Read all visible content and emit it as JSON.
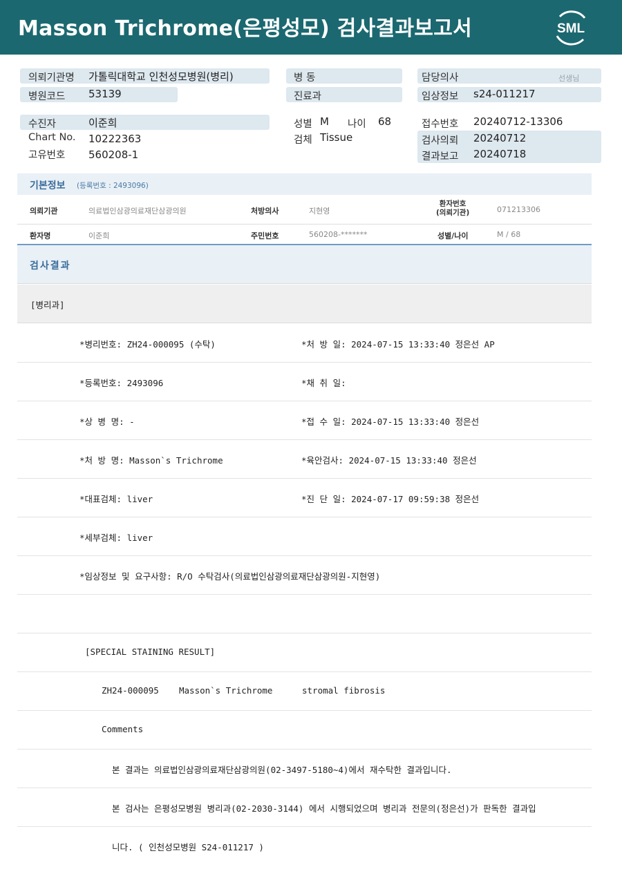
{
  "header": {
    "title": "Masson  Trichrome(은평성모) 검사결과보고서",
    "logo_text": "SML"
  },
  "top": {
    "request_org_label": "의뢰기관명",
    "request_org_value": "가톨릭대학교 인천성모병원(병리)",
    "hospital_code_label": "병원코드",
    "hospital_code_value": "53139",
    "ward_label": "병 동",
    "dept_label": "진료과",
    "doctor_label": "담당의사",
    "doctor_hint": "선생님",
    "clinical_label": "임상정보",
    "clinical_value": "s24-011217",
    "patient_label": "수진자",
    "patient_value": "이준희",
    "chart_label": "Chart No.",
    "chart_value": "10222363",
    "unique_label": "고유번호",
    "unique_value": "560208-1",
    "sex_label": "성별",
    "sex_value": "M",
    "age_label": "나이",
    "age_value": "68",
    "specimen_label": "검체",
    "specimen_value": "Tissue",
    "receipt_label": "접수번호",
    "receipt_value": "20240712-13306",
    "test_req_label": "검사의뢰",
    "test_req_value": "20240712",
    "report_label": "결과보고",
    "report_value": "20240718"
  },
  "basic": {
    "title": "기본정보",
    "reg_label": "(등록번호 : 2493096)",
    "row1": {
      "org_key": "의뢰기관",
      "org_val": "의료법인삼광의료재단삼광의원",
      "doc_key": "처방의사",
      "doc_val": "지현영",
      "pid_key_1": "환자번호",
      "pid_key_2": "(의뢰기관)",
      "pid_val": "071213306"
    },
    "row2": {
      "name_key": "환자명",
      "name_val": "이준희",
      "rrn_key": "주민번호",
      "rrn_val": "560208-*******",
      "sexage_key": "성별/나이",
      "sexage_val": "M / 68"
    }
  },
  "result": {
    "title": "검사결과",
    "section": "[병리과]",
    "lines": [
      {
        "left": "*병리번호: ZH24-000095 (수탁)",
        "right": "*처 방 일: 2024-07-15 13:33:40  정은선 AP"
      },
      {
        "left": "*등록번호: 2493096",
        "right": "*채 취 일:"
      },
      {
        "left": "*상 병 명: -",
        "right": "*접 수 일: 2024-07-15 13:33:40  정은선"
      },
      {
        "left": "*처 방 명: Masson`s Trichrome",
        "right": "*육안검사: 2024-07-15 13:33:40  정은선"
      },
      {
        "left": "*대표검체: liver",
        "right": "*진 단 일: 2024-07-17 09:59:38  정은선"
      },
      {
        "left": "*세부검체: liver",
        "right": ""
      }
    ],
    "clinical_note": "*임상정보 및 요구사항: R/O 수탁검사(의료법인삼광의료재단삼광의원-지현영)",
    "special_header": "[SPECIAL STAINING RESULT]",
    "stain_id": "ZH24-000095",
    "stain_name": "Masson`s Trichrome",
    "stain_result": "stromal fibrosis",
    "comments_label": "Comments",
    "comment1": "본 결과는 의료법인삼광의료재단삼광의원(02-3497-5180~4)에서 재수탁한 결과입니다.",
    "comment2": "본 검사는 은평성모병원 병리과(02-2030-3144) 에서 시행되었으며 병리과 전문의(정은선)가 판독한 결과입",
    "comment3": "니다. ( 인천성모병원 S24-011217 )"
  },
  "colors": {
    "header_bg": "#1b6870",
    "label_box": "#dde8ef",
    "section_bar": "#e9f0f6",
    "accent_blue": "#3a6d9a"
  }
}
